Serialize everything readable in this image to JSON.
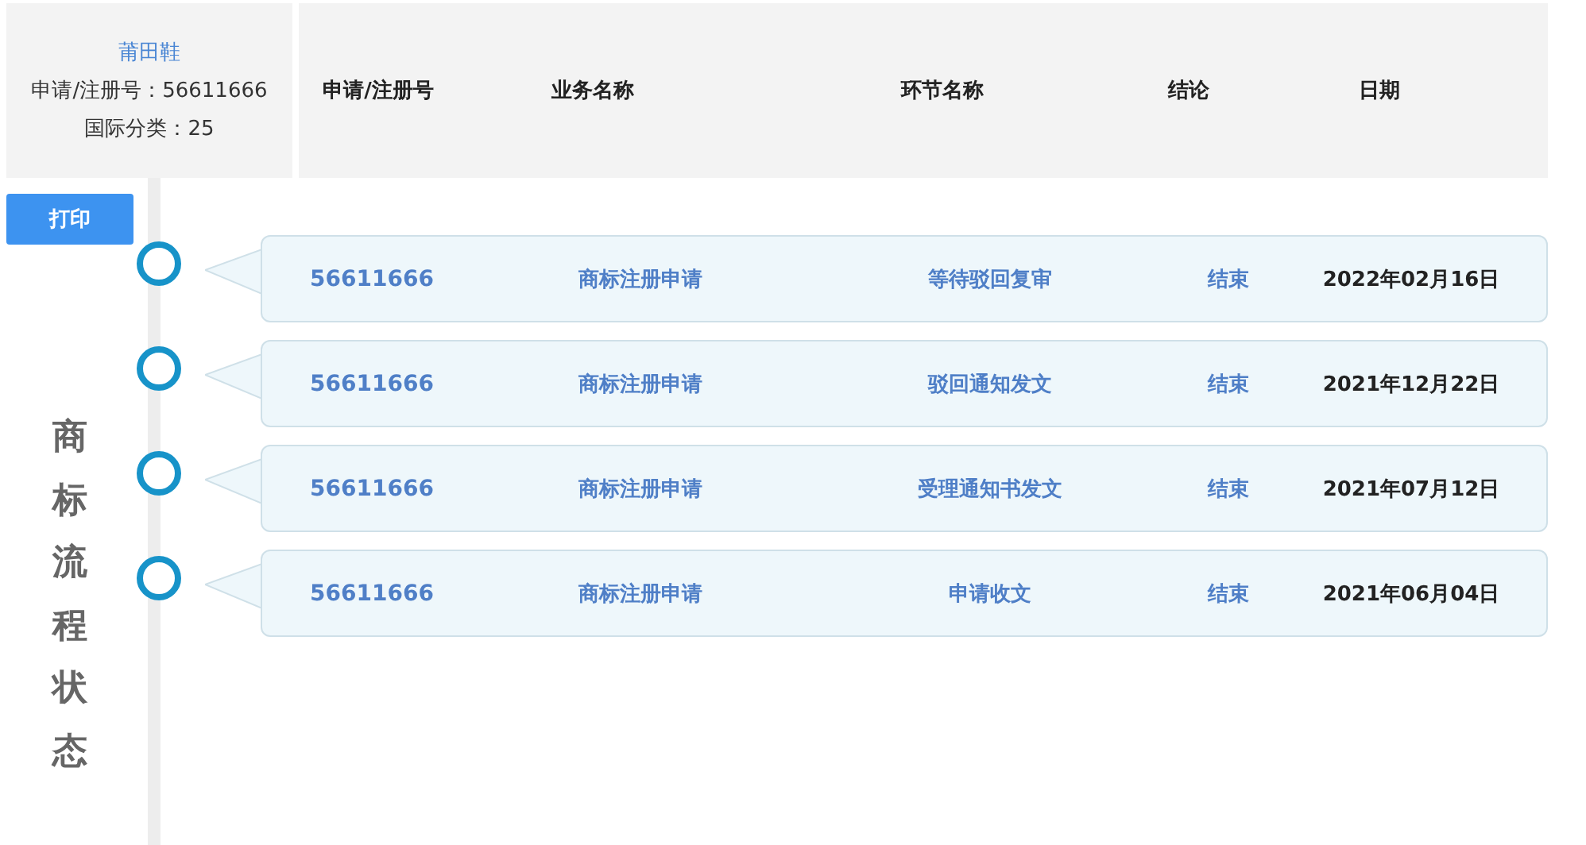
{
  "mark_card": {
    "name": "莆田鞋",
    "reg_no": "申请/注册号：56611666",
    "class": "国际分类：25"
  },
  "table": {
    "columns": [
      "申请/注册号",
      "业务名称",
      "环节名称",
      "结论",
      "日期"
    ],
    "rows": [
      {
        "cells": [
          "56611666",
          "商标注册申请",
          "等待驳回复审",
          "结束",
          "2022年02月16日"
        ]
      },
      {
        "cells": [
          "56611666",
          "商标注册申请",
          "驳回通知发文",
          "结束",
          "2021年12月22日"
        ]
      },
      {
        "cells": [
          "56611666",
          "商标注册申请",
          "受理通知书发文",
          "结束",
          "2021年07月12日"
        ]
      },
      {
        "cells": [
          "56611666",
          "商标注册申请",
          "申请收文",
          "结束",
          "2021年06月04日"
        ]
      }
    ]
  },
  "print_button": "打印",
  "side_title": "商标流程状态"
}
